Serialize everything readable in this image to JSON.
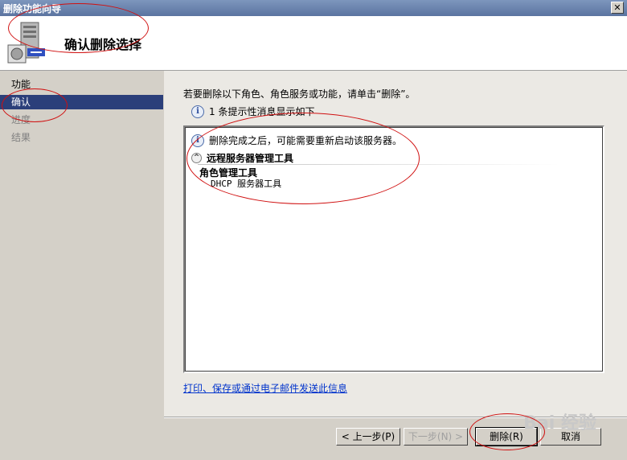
{
  "window": {
    "title": "删除功能向导",
    "close_glyph": "✕"
  },
  "header": {
    "title": "确认删除选择",
    "icon": "server-wizard-icon"
  },
  "nav": {
    "items": [
      {
        "label": "功能",
        "state": "normal"
      },
      {
        "label": "确认",
        "state": "selected"
      },
      {
        "label": "进度",
        "state": "dim"
      },
      {
        "label": "结果",
        "state": "dim"
      }
    ]
  },
  "main": {
    "instruction": "若要删除以下角色、角色服务或功能，请单击“删除”。",
    "message_count": "1 条提示性消息显示如下",
    "list": {
      "message": "删除完成之后，可能需要重新启动该服务器。",
      "group": "远程服务器管理工具",
      "subgroup": "角色管理工具",
      "item": "DHCP 服务器工具"
    },
    "link": "打印、保存或通过电子邮件发送此信息"
  },
  "buttons": {
    "prev": "< 上一步(P)",
    "next": "下一步(N) >",
    "remove": "删除(R)",
    "cancel": "取消"
  },
  "watermark": "Bai 经验",
  "colors": {
    "nav_selected": "#2b3f7a",
    "link": "#0033cc",
    "annotation": "#d01010"
  }
}
